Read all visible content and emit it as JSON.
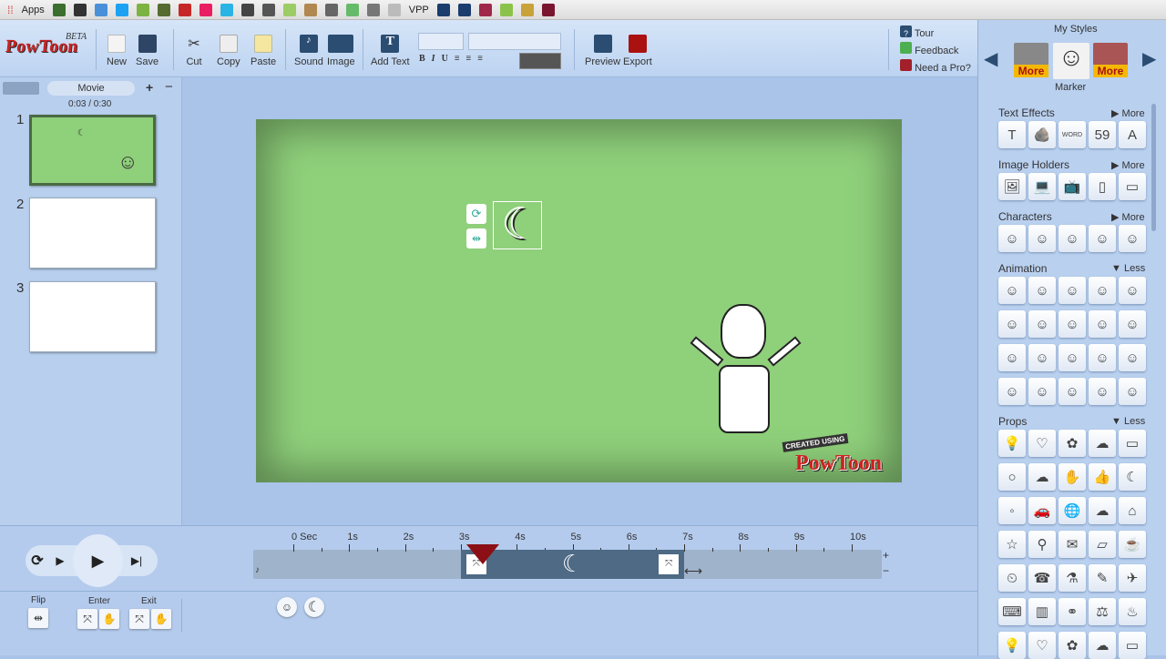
{
  "bookmarks": {
    "apps_label": "Apps",
    "vpp_label": "VPP",
    "colors": [
      "#3b6e2f",
      "#333",
      "#4a90d9",
      "#1da1f2",
      "#7cb342",
      "#556b2f",
      "#c62828",
      "#e91e63",
      "#2ab4e6",
      "#444",
      "#555",
      "#9ccc65",
      "#b08850",
      "#666",
      "#66bb6a",
      "#777",
      "#bbb",
      "#1a3d6e",
      "#1a3d6e",
      "#a0284a",
      "#8bc34a",
      "#c9a23a",
      "#7a1530"
    ]
  },
  "toolbar": {
    "logo": "PowToon",
    "beta": "BETA",
    "new": "New",
    "save": "Save",
    "cut": "Cut",
    "copy": "Copy",
    "paste": "Paste",
    "sound": "Sound",
    "image": "Image",
    "add_text": "Add Text",
    "bold": "B",
    "italic": "I",
    "underline": "U",
    "preview": "Preview",
    "export": "Export",
    "tour": "Tour",
    "feedback": "Feedback",
    "need_pro": "Need a Pro?"
  },
  "slides": {
    "mode": "Movie",
    "time": "0:03 / 0:30",
    "items": [
      "1",
      "2",
      "3"
    ]
  },
  "styles": {
    "title": "My Styles",
    "selected": "Marker",
    "more1": "More",
    "more2": "More"
  },
  "library": {
    "sections": [
      {
        "name": "Text Effects",
        "toggle": "More",
        "rows": 1,
        "icons": [
          "T",
          "🪨",
          "WORD",
          "59",
          "A"
        ]
      },
      {
        "name": "Image Holders",
        "toggle": "More",
        "rows": 1,
        "icons": [
          "🖼",
          "💻",
          "📺",
          "▯",
          "▭"
        ]
      },
      {
        "name": "Characters",
        "toggle": "More",
        "rows": 1,
        "icons": [
          "☺",
          "☺",
          "☺",
          "☺",
          "☺"
        ]
      },
      {
        "name": "Animation",
        "toggle": "Less",
        "rows": 4,
        "icons": [
          "☺"
        ]
      },
      {
        "name": "Props",
        "toggle": "Less",
        "rows": 7,
        "icons": [
          "💡",
          "♡",
          "✿",
          "☁",
          "▭",
          "○",
          "☁",
          "✋",
          "👍",
          "☾",
          "◦",
          "🚗",
          "🌐",
          "☁",
          "⌂",
          "☆",
          "⚲",
          "✉",
          "▱",
          "☕",
          "⏲",
          "☎",
          "⚗",
          "✎",
          "✈",
          "⌨",
          "▥",
          "⚭",
          "⚖",
          "♨"
        ]
      }
    ]
  },
  "timeline": {
    "ticks": [
      "0 Sec",
      "1s",
      "2s",
      "3s",
      "4s",
      "5s",
      "6s",
      "7s",
      "8s",
      "9s",
      "10s"
    ],
    "playhead_s": 3.4,
    "item_start_s": 3,
    "item_end_s": 7,
    "zoom_in": "+",
    "zoom_out": "−",
    "flip": "Flip",
    "enter": "Enter",
    "exit": "Exit"
  },
  "stage": {
    "watermark_top": "CREATED USING",
    "watermark": "PowToon",
    "bg": "#8fd07b"
  }
}
